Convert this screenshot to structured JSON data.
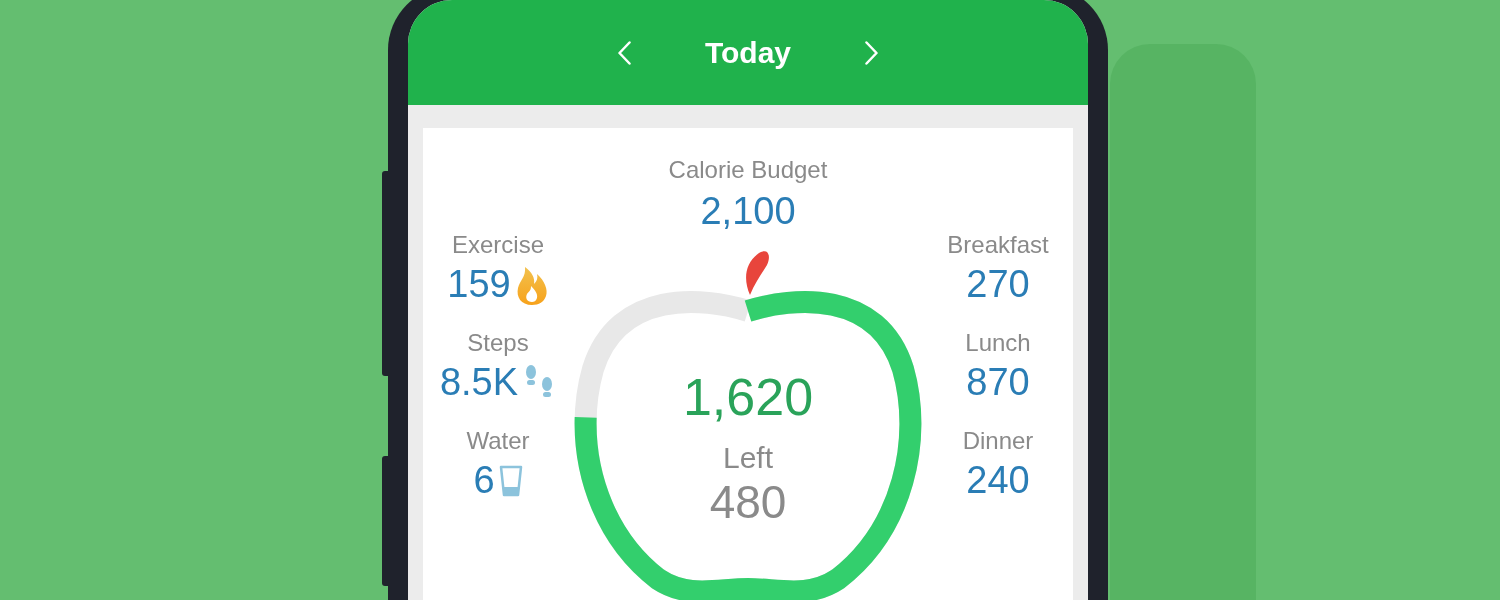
{
  "header": {
    "title": "Today"
  },
  "budget": {
    "label": "Calorie Budget",
    "value": "2,100"
  },
  "activity": [
    {
      "label": "Exercise",
      "value": "159",
      "kind": "flame"
    },
    {
      "label": "Steps",
      "value": "8.5K",
      "kind": "steps"
    },
    {
      "label": "Water",
      "value": "6",
      "kind": "glass"
    }
  ],
  "ring": {
    "eaten": "1,620",
    "left_label": "Left",
    "left_value": "480"
  },
  "meals": [
    {
      "label": "Breakfast",
      "value": "270"
    },
    {
      "label": "Lunch",
      "value": "870"
    },
    {
      "label": "Dinner",
      "value": "240"
    }
  ]
}
